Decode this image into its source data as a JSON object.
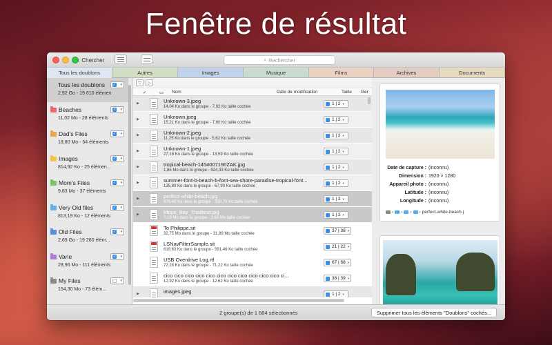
{
  "hero_title": "Fenêtre de résultat",
  "toolbar": {
    "back_label": "Chercher",
    "search_placeholder": "Rechercher"
  },
  "tabs": [
    {
      "label": "Tous les doublons",
      "color": "#dfe7f2"
    },
    {
      "label": "Autres",
      "color": "#d3dfc4"
    },
    {
      "label": "Images",
      "color": "#c2d2ea"
    },
    {
      "label": "Musique",
      "color": "#c9dccf"
    },
    {
      "label": "Films",
      "color": "#ebd3c4"
    },
    {
      "label": "Archives",
      "color": "#e3ccc2"
    },
    {
      "label": "Documents",
      "color": "#e6dac0"
    }
  ],
  "sidebar": {
    "items": [
      {
        "title": "Tous les doublons",
        "sub": "2,92 Go - 19 610 élémen",
        "color": "",
        "checked": true
      },
      {
        "title": "Beaches",
        "sub": "11,02 Mo - 28 éléments",
        "color": "#e8696b",
        "checked": true
      },
      {
        "title": "Dad's Files",
        "sub": "18,80 Mo - 54 éléments",
        "color": "#f0a54a",
        "checked": true
      },
      {
        "title": "Images",
        "sub": "814,92 Ko - 25 élémen...",
        "color": "#f2c44a",
        "checked": true
      },
      {
        "title": "Mom's Files",
        "sub": "9,83 Mo - 37 éléments",
        "color": "#7cc26b",
        "checked": true
      },
      {
        "title": "Very Old files",
        "sub": "813,19 Ko - 12 éléments",
        "color": "#6aaee8",
        "checked": true
      },
      {
        "title": "Old Files",
        "sub": "2,69 Go - 19 260 élém...",
        "color": "#5c8ee0",
        "checked": true
      },
      {
        "title": "Varie",
        "sub": "28,96 Mo - 111 éléments",
        "color": "#b27ad8",
        "checked": true
      },
      {
        "title": "My Files",
        "sub": "154,30 Mo - 73 élém...",
        "color": "#8a8a8a",
        "checked": false
      }
    ]
  },
  "columns": {
    "nom": "Nom",
    "date": "Date de modification",
    "taille": "Taille",
    "gen": "Ger"
  },
  "rows": [
    {
      "name": "Unknown-3.jpeg",
      "desc": "14,04 Ko dans le groupe - 7,02 Ko taille cochée",
      "count": "1 | 2",
      "icon": "image-file-icon"
    },
    {
      "name": "Unknown.jpeg",
      "desc": "15,21 Ko dans le groupe - 7,60 Ko taille cochée",
      "count": "1 | 2",
      "icon": "image-file-icon"
    },
    {
      "name": "Unknown-2.jpeg",
      "desc": "11,25 Ko dans le groupe - 5,62 Ko taille cochée",
      "count": "1 | 2",
      "icon": "image-file-icon"
    },
    {
      "name": "Unknown-1.jpeg",
      "desc": "27,18 Ko dans le groupe - 13,59 Ko taille cochée",
      "count": "1 | 2",
      "icon": "image-file-icon"
    },
    {
      "name": "tropical-beach-1454007190ZAK.jpg",
      "desc": "1,85 Mo dans le groupe - 924,33 Ko taille cochée",
      "count": "1 | 2",
      "icon": "image-file-icon"
    },
    {
      "name": "summer-font-b-beach-b-font-sea-shore-paradise-tropical-font...",
      "desc": "135,80 Ko dans le groupe - 67,90 Ko taille cochée",
      "count": "1 | 2",
      "icon": "image-file-icon"
    },
    {
      "name": "perfect-white-beach.jpg",
      "desc": "679,40 Ko dans le groupe - 339,70 Ko taille cochée",
      "count": "1 | 2",
      "icon": "image-file-icon"
    },
    {
      "name": "Maya_Bay_Thailand.jpg",
      "desc": "7,19 Mo dans le groupe - 3,60 Mo taille cochée",
      "count": "1 | 2",
      "icon": "image-file-icon"
    },
    {
      "name": "To Philippe.sit",
      "desc": "32,75 Mo dans le groupe - 31,89 Mo taille cochée",
      "count": "37 | 38",
      "icon": "pdf-file-icon"
    },
    {
      "name": "LSNavFilterSample.sit",
      "desc": "619,63 Ko dans le groupe - 591,46 Ko taille cochée",
      "count": "21 | 22",
      "icon": "pdf-file-icon"
    },
    {
      "name": "USB Overdrive Log.rtf",
      "desc": "72,28 Ko dans le groupe - 71,22 Ko taille cochée",
      "count": "67 | 68",
      "icon": "document-file-icon"
    },
    {
      "name": "cico cico cico cico cico cico cico cico cico cico cico ci...",
      "desc": "12,92 Ko dans le groupe - 12,62 Ko taille cochée",
      "count": "38 | 39",
      "icon": "document-file-icon"
    },
    {
      "name": "images.jpeg",
      "desc": "",
      "count": "1 | 2",
      "icon": "image-file-icon"
    }
  ],
  "preview": {
    "labels": {
      "capture": "Date de capture :",
      "dimension": "Dimension :",
      "camera": "Appareil photo :",
      "latitude": "Latitude :",
      "longitude": "Longitude :"
    },
    "values": {
      "capture": "(inconnu)",
      "dimension": "1920 × 1280",
      "camera": "(inconnu)",
      "latitude": "(inconnu)",
      "longitude": "(inconnu)"
    },
    "path_file": "perfect-white-beach.j"
  },
  "status": {
    "text": "2 groupe(s) de 1 684 sélectionnés",
    "delete_button": "Supprimer tous les éléments \"Doublons\" cochés..."
  }
}
